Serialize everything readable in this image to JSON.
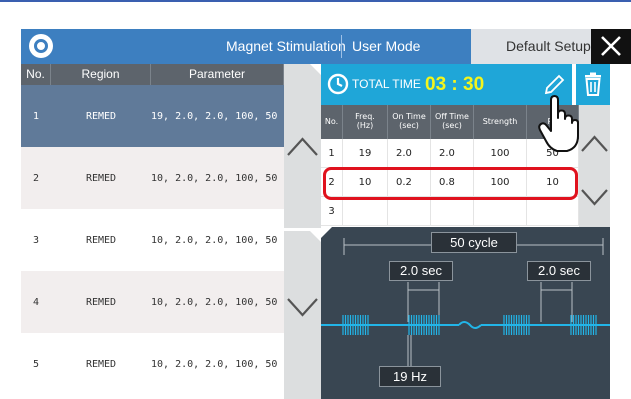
{
  "header": {
    "title": "Magnet Stimulation",
    "mode": "User Mode",
    "default_setup": "Default Setup",
    "close": "✕"
  },
  "left_table": {
    "headers": {
      "no": "No.",
      "region": "Region",
      "parameter": "Parameter"
    },
    "rows": [
      {
        "no": "1",
        "region": "REMED",
        "parameter": "19, 2.0,  2.0, 100,  50"
      },
      {
        "no": "2",
        "region": "REMED",
        "parameter": "10, 2.0,  2.0, 100,  50"
      },
      {
        "no": "3",
        "region": "REMED",
        "parameter": "10, 2.0,  2.0, 100,  50"
      },
      {
        "no": "4",
        "region": "REMED",
        "parameter": "10, 2.0,  2.0, 100,  50"
      },
      {
        "no": "5",
        "region": "REMED",
        "parameter": "10, 2.0,  2.0, 100,  50"
      }
    ]
  },
  "timer": {
    "label": "TOTAL TIME",
    "value": "03 : 30"
  },
  "param_table": {
    "headers": {
      "no": "No.",
      "freq": "Freq.",
      "freq_unit": "(Hz)",
      "on": "On Time",
      "on_unit": "(sec)",
      "off": "Off Time",
      "off_unit": "(sec)",
      "strength": "Strength",
      "rep": "Re"
    },
    "rows": [
      {
        "no": "1",
        "freq": "19",
        "on": "2.0",
        "off": "2.0",
        "strength": "100",
        "rep": "50"
      },
      {
        "no": "2",
        "freq": "10",
        "on": "0.2",
        "off": "0.8",
        "strength": "100",
        "rep": "10"
      },
      {
        "no": "3",
        "freq": "",
        "on": "",
        "off": "",
        "strength": "",
        "rep": ""
      }
    ]
  },
  "waveform": {
    "cycle": "50 cycle",
    "on_time": "2.0 sec",
    "off_time": "2.0 sec",
    "frequency": "19 Hz"
  },
  "colors": {
    "header": "#3d7fc0",
    "selected_row": "#607a99",
    "timer_bar": "#1fa6d8",
    "timer_value": "#f3f51c",
    "highlight": "#e0121e",
    "wave_bg": "#394652",
    "wave_signal": "#22b5e8"
  },
  "icons": {
    "logo": "app-logo-icon",
    "close": "close-icon",
    "clock": "clock-icon",
    "edit": "pencil-icon",
    "delete": "trash-icon",
    "pointer": "hand-pointer-icon",
    "up": "chevron-up-icon",
    "down": "chevron-down-icon"
  }
}
